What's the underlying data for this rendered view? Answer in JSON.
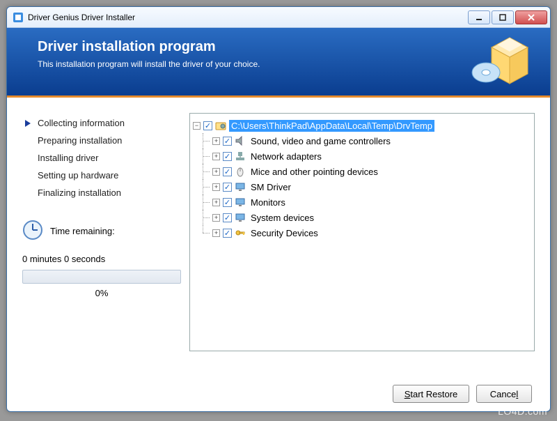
{
  "window": {
    "title": "Driver Genius Driver Installer"
  },
  "header": {
    "title": "Driver installation program",
    "subtitle": "This installation program will install the driver of your choice."
  },
  "steps": [
    "Collecting information",
    "Preparing installation",
    "Installing driver",
    "Setting up hardware",
    "Finalizing installation"
  ],
  "active_step": 0,
  "time": {
    "label": "Time remaining:",
    "value": "0 minutes 0 seconds",
    "percent": "0%"
  },
  "tree": {
    "root": {
      "label": "C:\\Users\\ThinkPad\\AppData\\Local\\Temp\\DrvTemp",
      "expanded": true,
      "checked": true,
      "selected": true,
      "icon": "folder-gear-icon"
    },
    "children": [
      {
        "label": "Sound, video and game controllers",
        "icon": "speaker-icon"
      },
      {
        "label": "Network adapters",
        "icon": "network-icon"
      },
      {
        "label": "Mice and other pointing devices",
        "icon": "mouse-icon"
      },
      {
        "label": "SM Driver",
        "icon": "monitor-icon"
      },
      {
        "label": "Monitors",
        "icon": "monitor-icon"
      },
      {
        "label": "System devices",
        "icon": "monitor-icon"
      },
      {
        "label": "Security Devices",
        "icon": "key-icon"
      }
    ]
  },
  "buttons": {
    "start": "Start Restore",
    "cancel": "Cancel"
  },
  "watermark": "LO4D.com"
}
